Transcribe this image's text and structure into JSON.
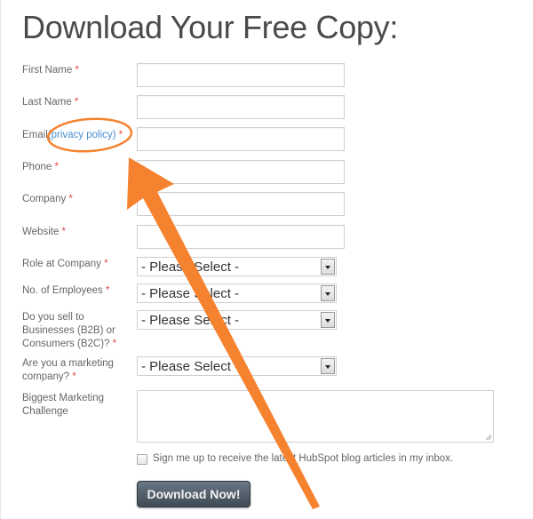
{
  "title": "Download Your Free Copy:",
  "required_marker": "*",
  "fields": {
    "first_name": {
      "label": "First Name",
      "value": ""
    },
    "last_name": {
      "label": "Last Name",
      "value": ""
    },
    "email": {
      "label": "Email",
      "link_text": "(privacy policy)",
      "value": ""
    },
    "phone": {
      "label": "Phone",
      "value": ""
    },
    "company": {
      "label": "Company",
      "value": ""
    },
    "website": {
      "label": "Website",
      "value": ""
    },
    "role": {
      "label": "Role at Company",
      "selected": "- Please Select -"
    },
    "employees": {
      "label": "No. of Employees",
      "selected": "- Please Select -"
    },
    "b2b_b2c": {
      "label": "Do you sell to Businesses (B2B) or Consumers (B2C)?",
      "selected": "- Please Select -"
    },
    "marketing_company": {
      "label": "Are you a marketing company?",
      "selected": "- Please Select -"
    },
    "challenge": {
      "label": "Biggest Marketing Challenge",
      "value": ""
    }
  },
  "subscribe": {
    "label": "Sign me up to receive the latest HubSpot blog articles in my inbox.",
    "checked": false
  },
  "submit_label": "Download Now!",
  "annotation": {
    "color": "#f5822f",
    "shapes": [
      "ellipse-highlight",
      "arrow"
    ]
  }
}
